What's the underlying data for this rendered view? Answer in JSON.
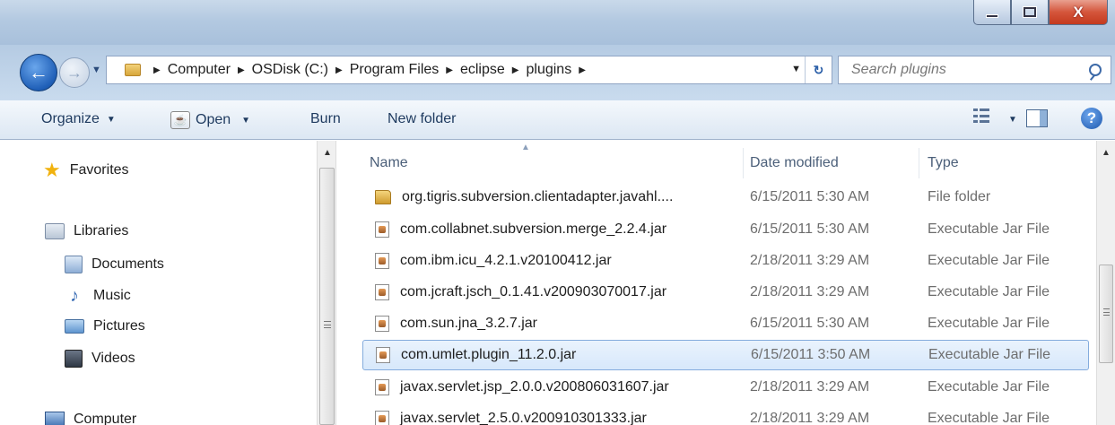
{
  "window": {
    "buttons": {
      "minimize": "–",
      "maximize": "□",
      "close": "X"
    }
  },
  "nav": {
    "back_icon": "back-arrow-icon",
    "forward_icon": "forward-arrow-icon",
    "breadcrumb": [
      "Computer",
      "OSDisk (C:)",
      "Program Files",
      "eclipse",
      "plugins"
    ]
  },
  "search": {
    "placeholder": "Search plugins"
  },
  "toolbar": {
    "organize": "Organize",
    "open": "Open",
    "burn": "Burn",
    "new_folder": "New folder"
  },
  "sidebar": {
    "favorites": "Favorites",
    "libraries": "Libraries",
    "items": [
      "Documents",
      "Music",
      "Pictures",
      "Videos"
    ],
    "computer": "Computer"
  },
  "columns": {
    "name": "Name",
    "date": "Date modified",
    "type": "Type"
  },
  "files": [
    {
      "name": "org.tigris.subversion.clientadapter.javahl....",
      "date": "6/15/2011 5:30 AM",
      "type": "File folder",
      "icon": "folder-icon"
    },
    {
      "name": "com.collabnet.subversion.merge_2.2.4.jar",
      "date": "6/15/2011 5:30 AM",
      "type": "Executable Jar File",
      "icon": "jar-file-icon"
    },
    {
      "name": "com.ibm.icu_4.2.1.v20100412.jar",
      "date": "2/18/2011 3:29 AM",
      "type": "Executable Jar File",
      "icon": "jar-file-icon"
    },
    {
      "name": "com.jcraft.jsch_0.1.41.v200903070017.jar",
      "date": "2/18/2011 3:29 AM",
      "type": "Executable Jar File",
      "icon": "jar-file-icon"
    },
    {
      "name": "com.sun.jna_3.2.7.jar",
      "date": "6/15/2011 5:30 AM",
      "type": "Executable Jar File",
      "icon": "jar-file-icon"
    },
    {
      "name": "com.umlet.plugin_11.2.0.jar",
      "date": "6/15/2011 3:50 AM",
      "type": "Executable Jar File",
      "icon": "jar-file-icon",
      "selected": true
    },
    {
      "name": "javax.servlet.jsp_2.0.0.v200806031607.jar",
      "date": "2/18/2011 3:29 AM",
      "type": "Executable Jar File",
      "icon": "jar-file-icon"
    },
    {
      "name": "javax.servlet_2.5.0.v200910301333.jar",
      "date": "2/18/2011 3:29 AM",
      "type": "Executable Jar File",
      "icon": "jar-file-icon"
    }
  ],
  "colors": {
    "accent": "#1f5fb7",
    "selection": "#d7e8fb",
    "close": "#c43a1f"
  }
}
